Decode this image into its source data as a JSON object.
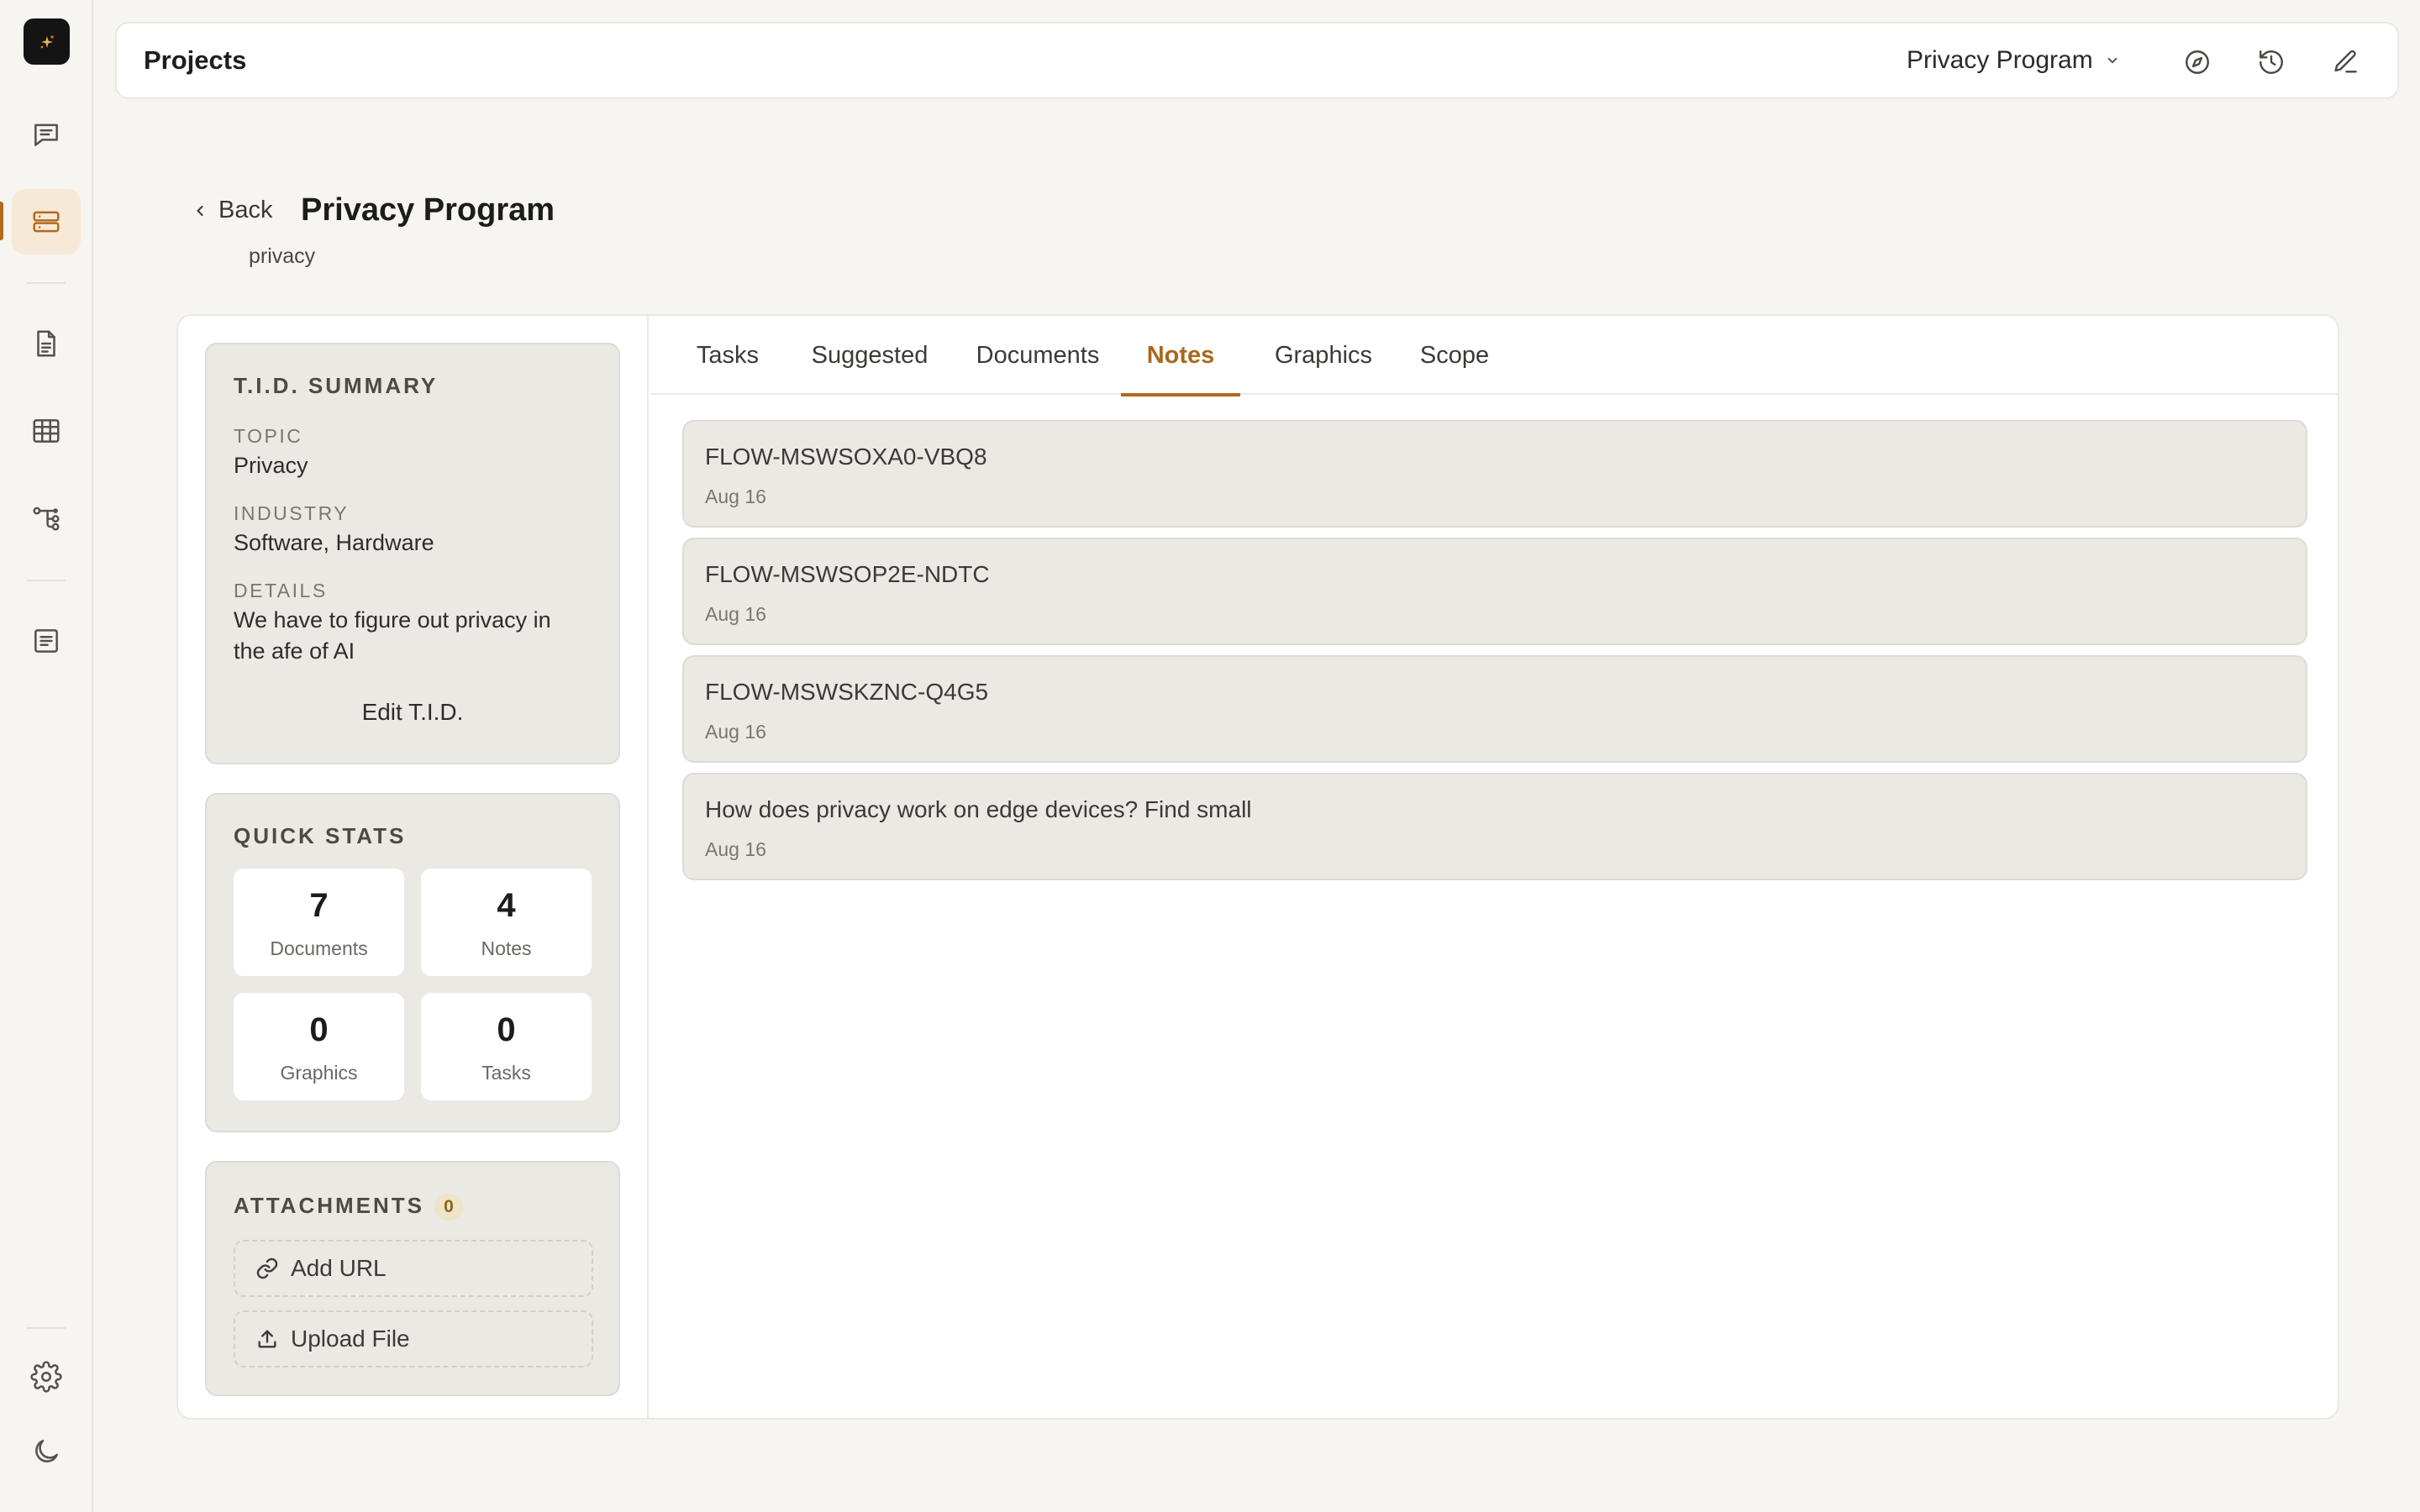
{
  "app": {
    "title": "Projects"
  },
  "topbar": {
    "project_selector": "Privacy Program",
    "icons": [
      "compass-icon",
      "history-icon",
      "edit-icon"
    ]
  },
  "rail": {
    "items": [
      "chat-icon",
      "projects-icon",
      "document-icon",
      "table-icon",
      "workflow-icon",
      "notes-icon",
      "settings-icon",
      "dark-mode-icon"
    ],
    "active": "projects-icon"
  },
  "header": {
    "back_label": "Back",
    "title": "Privacy Program",
    "subtitle": "privacy"
  },
  "summary": {
    "heading": "T.I.D. SUMMARY",
    "topic_label": "TOPIC",
    "topic_value": "Privacy",
    "industry_label": "INDUSTRY",
    "industry_value": "Software, Hardware",
    "details_label": "DETAILS",
    "details_value": "We have to figure out privacy in the afe of AI",
    "edit_label": "Edit T.I.D."
  },
  "stats": {
    "heading": "QUICK STATS",
    "items": [
      {
        "value": "7",
        "label": "Documents"
      },
      {
        "value": "4",
        "label": "Notes"
      },
      {
        "value": "0",
        "label": "Graphics"
      },
      {
        "value": "0",
        "label": "Tasks"
      }
    ]
  },
  "attachments": {
    "heading": "ATTACHMENTS",
    "count": "0",
    "add_url": "Add URL",
    "upload_file": "Upload File"
  },
  "tabs": {
    "items": [
      "Tasks",
      "Suggested",
      "Documents",
      "Notes",
      "Graphics",
      "Scope"
    ],
    "active": "Notes"
  },
  "notes": [
    {
      "title": "FLOW-MSWSOXA0-VBQ8",
      "date": "Aug 16"
    },
    {
      "title": "FLOW-MSWSOP2E-NDTC",
      "date": "Aug 16"
    },
    {
      "title": "FLOW-MSWSKZNC-Q4G5",
      "date": "Aug 16"
    },
    {
      "title": "How does privacy work on edge devices? Find small",
      "date": "Aug 16"
    }
  ],
  "colors": {
    "accent": "#b06a1e",
    "background": "#f6f5f1",
    "panel": "#ebe9e4"
  }
}
